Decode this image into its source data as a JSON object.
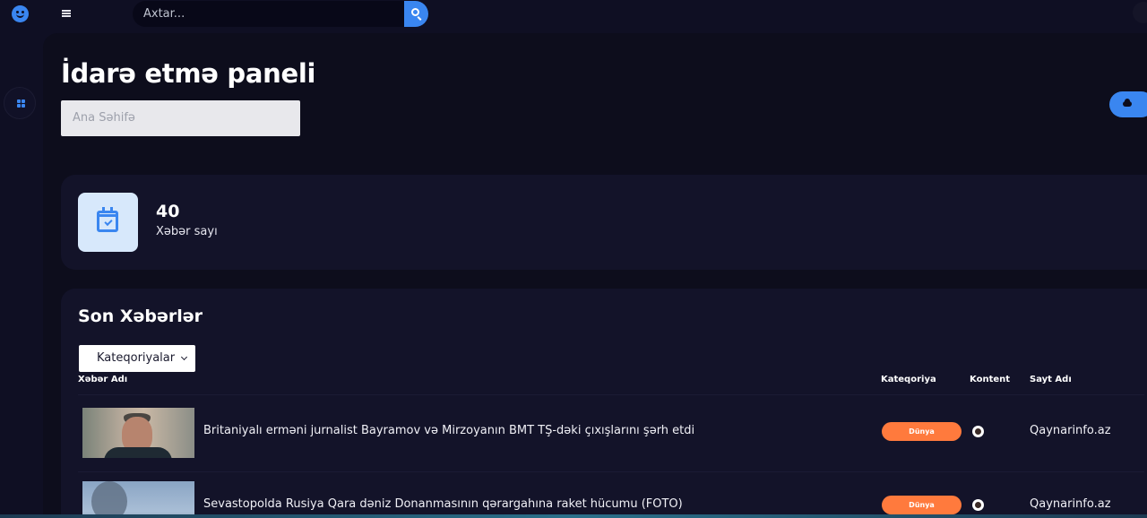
{
  "topbar": {
    "search_placeholder": "Axtar..."
  },
  "page": {
    "title": "İdarə etmə paneli",
    "breadcrumb": "Ana Səhifə"
  },
  "stats": {
    "value": "40",
    "label": "Xəbər sayı"
  },
  "news": {
    "title": "Son Xəbərlər",
    "filter_label": "Kateqoriyalar",
    "columns": {
      "name": "Xəbər Adı",
      "category": "Kateqoriya",
      "content": "Kontent",
      "site": "Sayt Adı"
    },
    "rows": [
      {
        "title": "Britaniyalı erməni jurnalist Bayramov və Mirzoyanın BMT TŞ-dəki çıxışlarını şərh etdi",
        "category": "Dünya",
        "site": "Qaynarinfo.az"
      },
      {
        "title": "Sevastopolda Rusiya Qara dəniz Donanmasının qərargahına raket hücumu (FOTO)",
        "category": "Dünya",
        "site": "Qaynarinfo.az"
      }
    ]
  },
  "colors": {
    "accent": "#3a86f0",
    "badge": "#ff7a3d",
    "background": "#0f0f23",
    "card": "#131329"
  },
  "icons": [
    "smiley-logo-icon",
    "menu-icon",
    "search-icon",
    "dashboard-grid-icon",
    "cloud-download-icon",
    "calendar-check-icon",
    "eye-icon"
  ]
}
